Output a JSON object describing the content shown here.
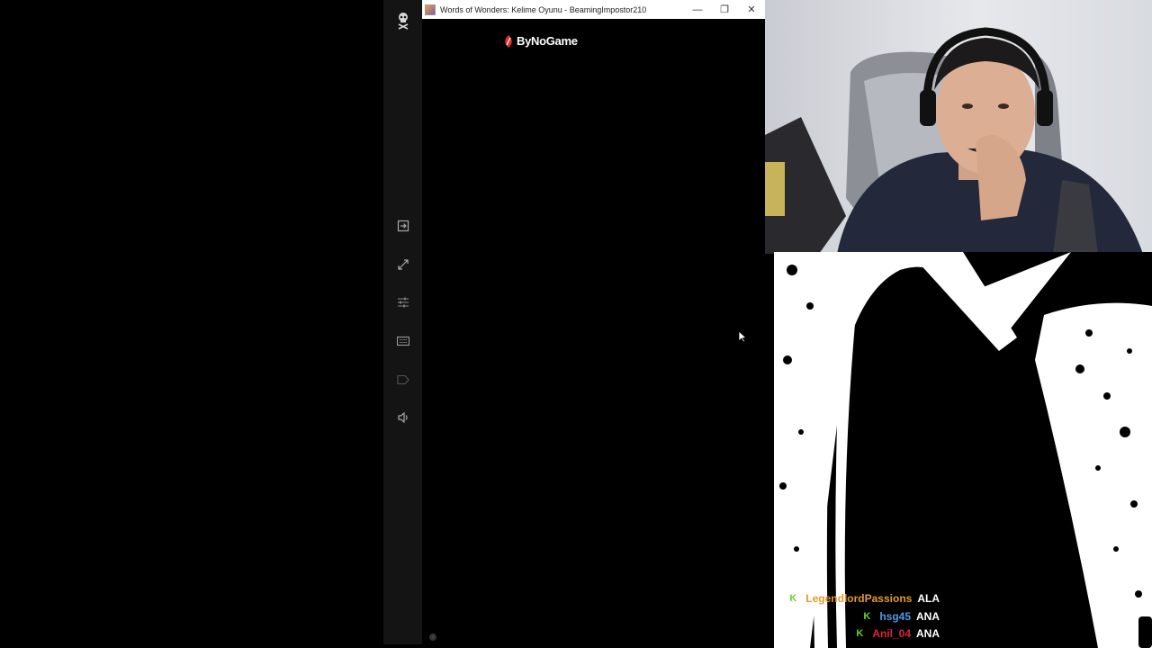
{
  "window": {
    "title": "Words of Wonders: Kelime Oyunu - BeamingImpostor210",
    "minimize_glyph": "—",
    "restore_glyph": "❐",
    "close_glyph": "✕",
    "brand": "ByNoGame"
  },
  "toolbar": {
    "items": [
      {
        "icon": "skull-icon"
      },
      {
        "icon": "exit-icon"
      },
      {
        "icon": "expand-icon"
      },
      {
        "icon": "sliders-icon"
      },
      {
        "icon": "keyboard-icon"
      },
      {
        "icon": "label-icon"
      },
      {
        "icon": "volume-icon"
      }
    ]
  },
  "chat": [
    {
      "badge": "K",
      "user": "LegendlordPassions",
      "user_color": "#e39a2f",
      "message": "ALA"
    },
    {
      "badge": "K",
      "user": "hsg45",
      "user_color": "#4d9be6",
      "message": "ANA"
    },
    {
      "badge": "K",
      "user": "Anil_04",
      "user_color": "#e0213a",
      "message": "ANA"
    }
  ],
  "footer": {
    "info_glyph": "i"
  }
}
